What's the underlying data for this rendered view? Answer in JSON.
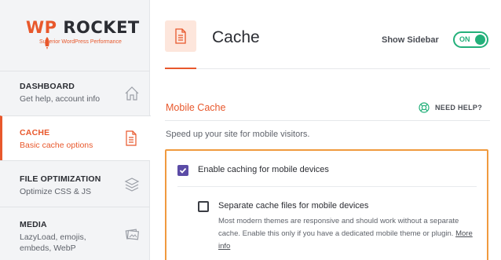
{
  "logo": {
    "wp": "WP",
    "rocket": "ROCKET",
    "tagline": "Superior WordPress Performance",
    "color": "#e8582c"
  },
  "nav": [
    {
      "title": "DASHBOARD",
      "sub": "Get help, account info",
      "icon": "house-icon"
    },
    {
      "title": "CACHE",
      "sub": "Basic cache options",
      "icon": "document-icon"
    },
    {
      "title": "FILE OPTIMIZATION",
      "sub": "Optimize CSS & JS",
      "icon": "layers-icon"
    },
    {
      "title": "MEDIA",
      "sub_lines": [
        "LazyLoad, emojis,",
        "embeds, WebP"
      ],
      "icon": "images-icon"
    }
  ],
  "header": {
    "title": "Cache",
    "show_sidebar_label": "Show Sidebar",
    "toggle_text": "ON",
    "toggle_on": true,
    "accent_color": "#23b07a"
  },
  "section": {
    "title": "Mobile Cache",
    "help_label": "NEED HELP?",
    "description": "Speed up your site for mobile visitors."
  },
  "options": {
    "enable_mobile": {
      "label": "Enable caching for mobile devices",
      "checked": true
    },
    "separate_files": {
      "label": "Separate cache files for mobile devices",
      "checked": false,
      "description": "Most modern themes are responsive and should work without a separate cache. Enable this only if you have a dedicated mobile theme or plugin.",
      "link_text": "More info"
    }
  }
}
